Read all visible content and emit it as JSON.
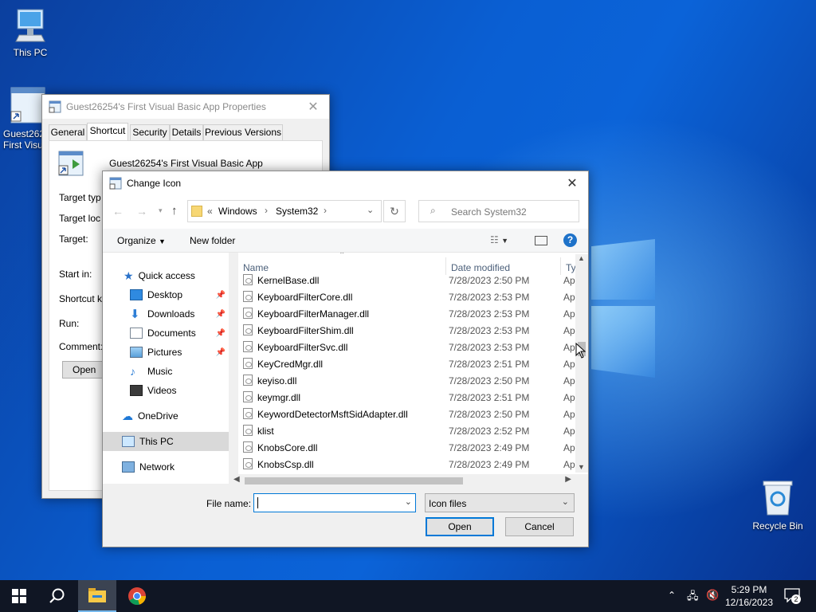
{
  "desktop": {
    "icons": [
      {
        "label": "This PC"
      },
      {
        "label": "Guest26254's First Visual Basic App",
        "visible_label": "Guest262 First Visu"
      },
      {
        "label": "Recycle Bin"
      }
    ]
  },
  "properties_window": {
    "title": "Guest26254's First Visual Basic App Properties",
    "tabs": [
      "General",
      "Shortcut",
      "Security",
      "Details",
      "Previous Versions"
    ],
    "active_tab": "Shortcut",
    "app_name": "Guest26254's First Visual Basic App",
    "labels": {
      "target_type": "Target typ",
      "target_location": "Target loc",
      "target": "Target:",
      "start_in": "Start in:",
      "shortcut_key": "Shortcut k",
      "run": "Run:",
      "comment": "Comment:",
      "open_button": "Open"
    }
  },
  "dialog": {
    "title": "Change Icon",
    "breadcrumb": {
      "overflow": "«",
      "items": [
        "Windows",
        "System32"
      ]
    },
    "search_placeholder": "Search System32",
    "toolbar": {
      "organize": "Organize",
      "new_folder": "New folder",
      "help": "?"
    },
    "nav_pane": [
      {
        "label": "Quick access",
        "icon": "star-icon"
      },
      {
        "label": "Desktop",
        "icon": "desktop-folder-icon",
        "pinned": true
      },
      {
        "label": "Downloads",
        "icon": "download-arrow-icon",
        "pinned": true
      },
      {
        "label": "Documents",
        "icon": "documents-icon",
        "pinned": true
      },
      {
        "label": "Pictures",
        "icon": "pictures-icon",
        "pinned": true
      },
      {
        "label": "Music",
        "icon": "music-note-icon"
      },
      {
        "label": "Videos",
        "icon": "film-icon"
      },
      {
        "label": "OneDrive",
        "icon": "cloud-icon"
      },
      {
        "label": "This PC",
        "icon": "computer-icon",
        "selected": true
      },
      {
        "label": "Network",
        "icon": "network-icon"
      }
    ],
    "columns": {
      "name": "Name",
      "date": "Date modified",
      "type": "Ty"
    },
    "files": [
      {
        "name": "KernelBase.dll",
        "date": "7/28/2023 2:50 PM",
        "type": "Ap"
      },
      {
        "name": "KeyboardFilterCore.dll",
        "date": "7/28/2023 2:53 PM",
        "type": "Ap"
      },
      {
        "name": "KeyboardFilterManager.dll",
        "date": "7/28/2023 2:53 PM",
        "type": "Ap"
      },
      {
        "name": "KeyboardFilterShim.dll",
        "date": "7/28/2023 2:53 PM",
        "type": "Ap"
      },
      {
        "name": "KeyboardFilterSvc.dll",
        "date": "7/28/2023 2:53 PM",
        "type": "Ap"
      },
      {
        "name": "KeyCredMgr.dll",
        "date": "7/28/2023 2:51 PM",
        "type": "Ap"
      },
      {
        "name": "keyiso.dll",
        "date": "7/28/2023 2:50 PM",
        "type": "Ap"
      },
      {
        "name": "keymgr.dll",
        "date": "7/28/2023 2:51 PM",
        "type": "Ap"
      },
      {
        "name": "KeywordDetectorMsftSidAdapter.dll",
        "date": "7/28/2023 2:50 PM",
        "type": "Ap"
      },
      {
        "name": "klist",
        "date": "7/28/2023 2:52 PM",
        "type": "Ap"
      },
      {
        "name": "KnobsCore.dll",
        "date": "7/28/2023 2:49 PM",
        "type": "Ap"
      },
      {
        "name": "KnobsCsp.dll",
        "date": "7/28/2023 2:49 PM",
        "type": "Ap"
      }
    ],
    "file_name_label": "File name:",
    "file_name_value": "",
    "file_type": "Icon files",
    "open_button": "Open",
    "cancel_button": "Cancel"
  },
  "taskbar": {
    "time": "5:29 PM",
    "date": "12/16/2023",
    "notification_count": "2"
  }
}
